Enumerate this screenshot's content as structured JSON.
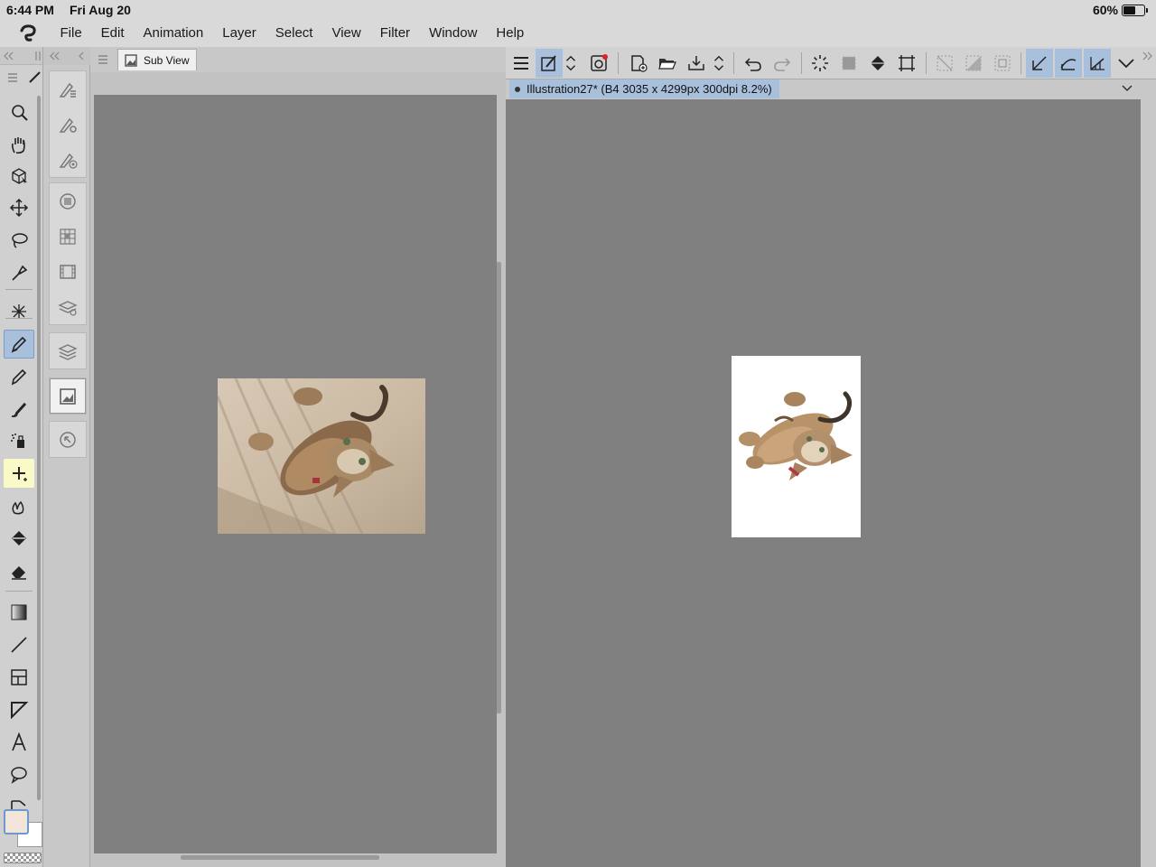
{
  "status": {
    "time": "6:44 PM",
    "date": "Fri Aug 20",
    "battery": "60%",
    "battery_level": 0.6
  },
  "menu": [
    "File",
    "Edit",
    "Animation",
    "Layer",
    "Select",
    "View",
    "Filter",
    "Window",
    "Help"
  ],
  "subview": {
    "tab_label": "Sub View"
  },
  "document": {
    "tab_label": "Illustration27* (B4 3035 x 4299px 300dpi 8.2%)"
  },
  "tools": [
    {
      "name": "zoom-icon"
    },
    {
      "name": "hand-icon"
    },
    {
      "name": "operation-icon"
    },
    {
      "name": "move-icon"
    },
    {
      "name": "lasso-select-icon"
    },
    {
      "name": "eyedropper-icon"
    },
    {
      "name": "auto-select-icon"
    },
    {
      "name": "pen-icon",
      "active": true
    },
    {
      "name": "pencil-icon"
    },
    {
      "name": "brush-icon"
    },
    {
      "name": "airbrush-icon"
    },
    {
      "name": "decoration-icon",
      "highlight": true
    },
    {
      "name": "blend-icon"
    },
    {
      "name": "fill-icon"
    },
    {
      "name": "eraser-icon"
    },
    {
      "name": "gradient-icon"
    },
    {
      "name": "line-icon"
    },
    {
      "name": "frame-icon"
    },
    {
      "name": "ruler-icon"
    },
    {
      "name": "text-icon"
    },
    {
      "name": "balloon-icon"
    },
    {
      "name": "correct-line-icon"
    }
  ],
  "colors": {
    "main": "#f1e4d8",
    "sub": "#ffffff",
    "accent": "#a9c0dd"
  }
}
